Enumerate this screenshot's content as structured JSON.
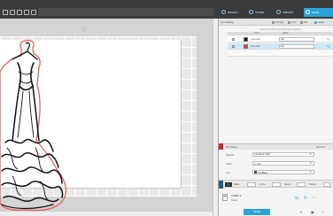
{
  "topbar": {
    "doc_title": "",
    "tabs": [
      {
        "label": "DESIGN",
        "icon": "design-icon",
        "active": false
      },
      {
        "label": "STORE",
        "icon": "store-icon",
        "active": false
      },
      {
        "label": "LIBRARY",
        "icon": "library-icon",
        "active": false
      },
      {
        "label": "SEND",
        "icon": "send-icon",
        "active": true
      }
    ]
  },
  "colors": {
    "accent": "#2aa3d8",
    "topbar": "#3a3b3d",
    "cut_line": "#e06060",
    "settings_red": "#c62828",
    "blade_blue": "#1f5f8b"
  },
  "panel": {
    "header_label": "Cut Setting",
    "modes": [
      {
        "label": "Simple",
        "on": false
      },
      {
        "label": "Line",
        "on": false
      },
      {
        "label": "Fill",
        "on": false
      },
      {
        "label": "Layer",
        "on": true
      }
    ],
    "instructions": "Select the action you would like to perform",
    "table": {
      "headers": [
        "",
        "",
        "Color",
        "Action",
        ""
      ],
      "rows": [
        {
          "checked": true,
          "swatch": "#111111",
          "name": "Line color",
          "action": "Cut",
          "selected": false
        },
        {
          "checked": true,
          "swatch": "#e53935",
          "name": "Line color",
          "action": "Cut",
          "selected": true
        }
      ]
    },
    "settings": {
      "title": "Cut Setting",
      "right_label": "Add Tool",
      "material_label": "Material",
      "material_value": "Cardstock, Plain",
      "action_label": "Action",
      "action_value": "Cut",
      "tool_label": "Tool",
      "tool_value": "AutoBlade"
    },
    "blade": {
      "label": "Blade",
      "force_label": "Force",
      "speed_label": "Speed",
      "passes_label": "Passes"
    },
    "device": {
      "name": "CAMEO 4",
      "status": "Ready"
    },
    "send_label": "SEND"
  }
}
